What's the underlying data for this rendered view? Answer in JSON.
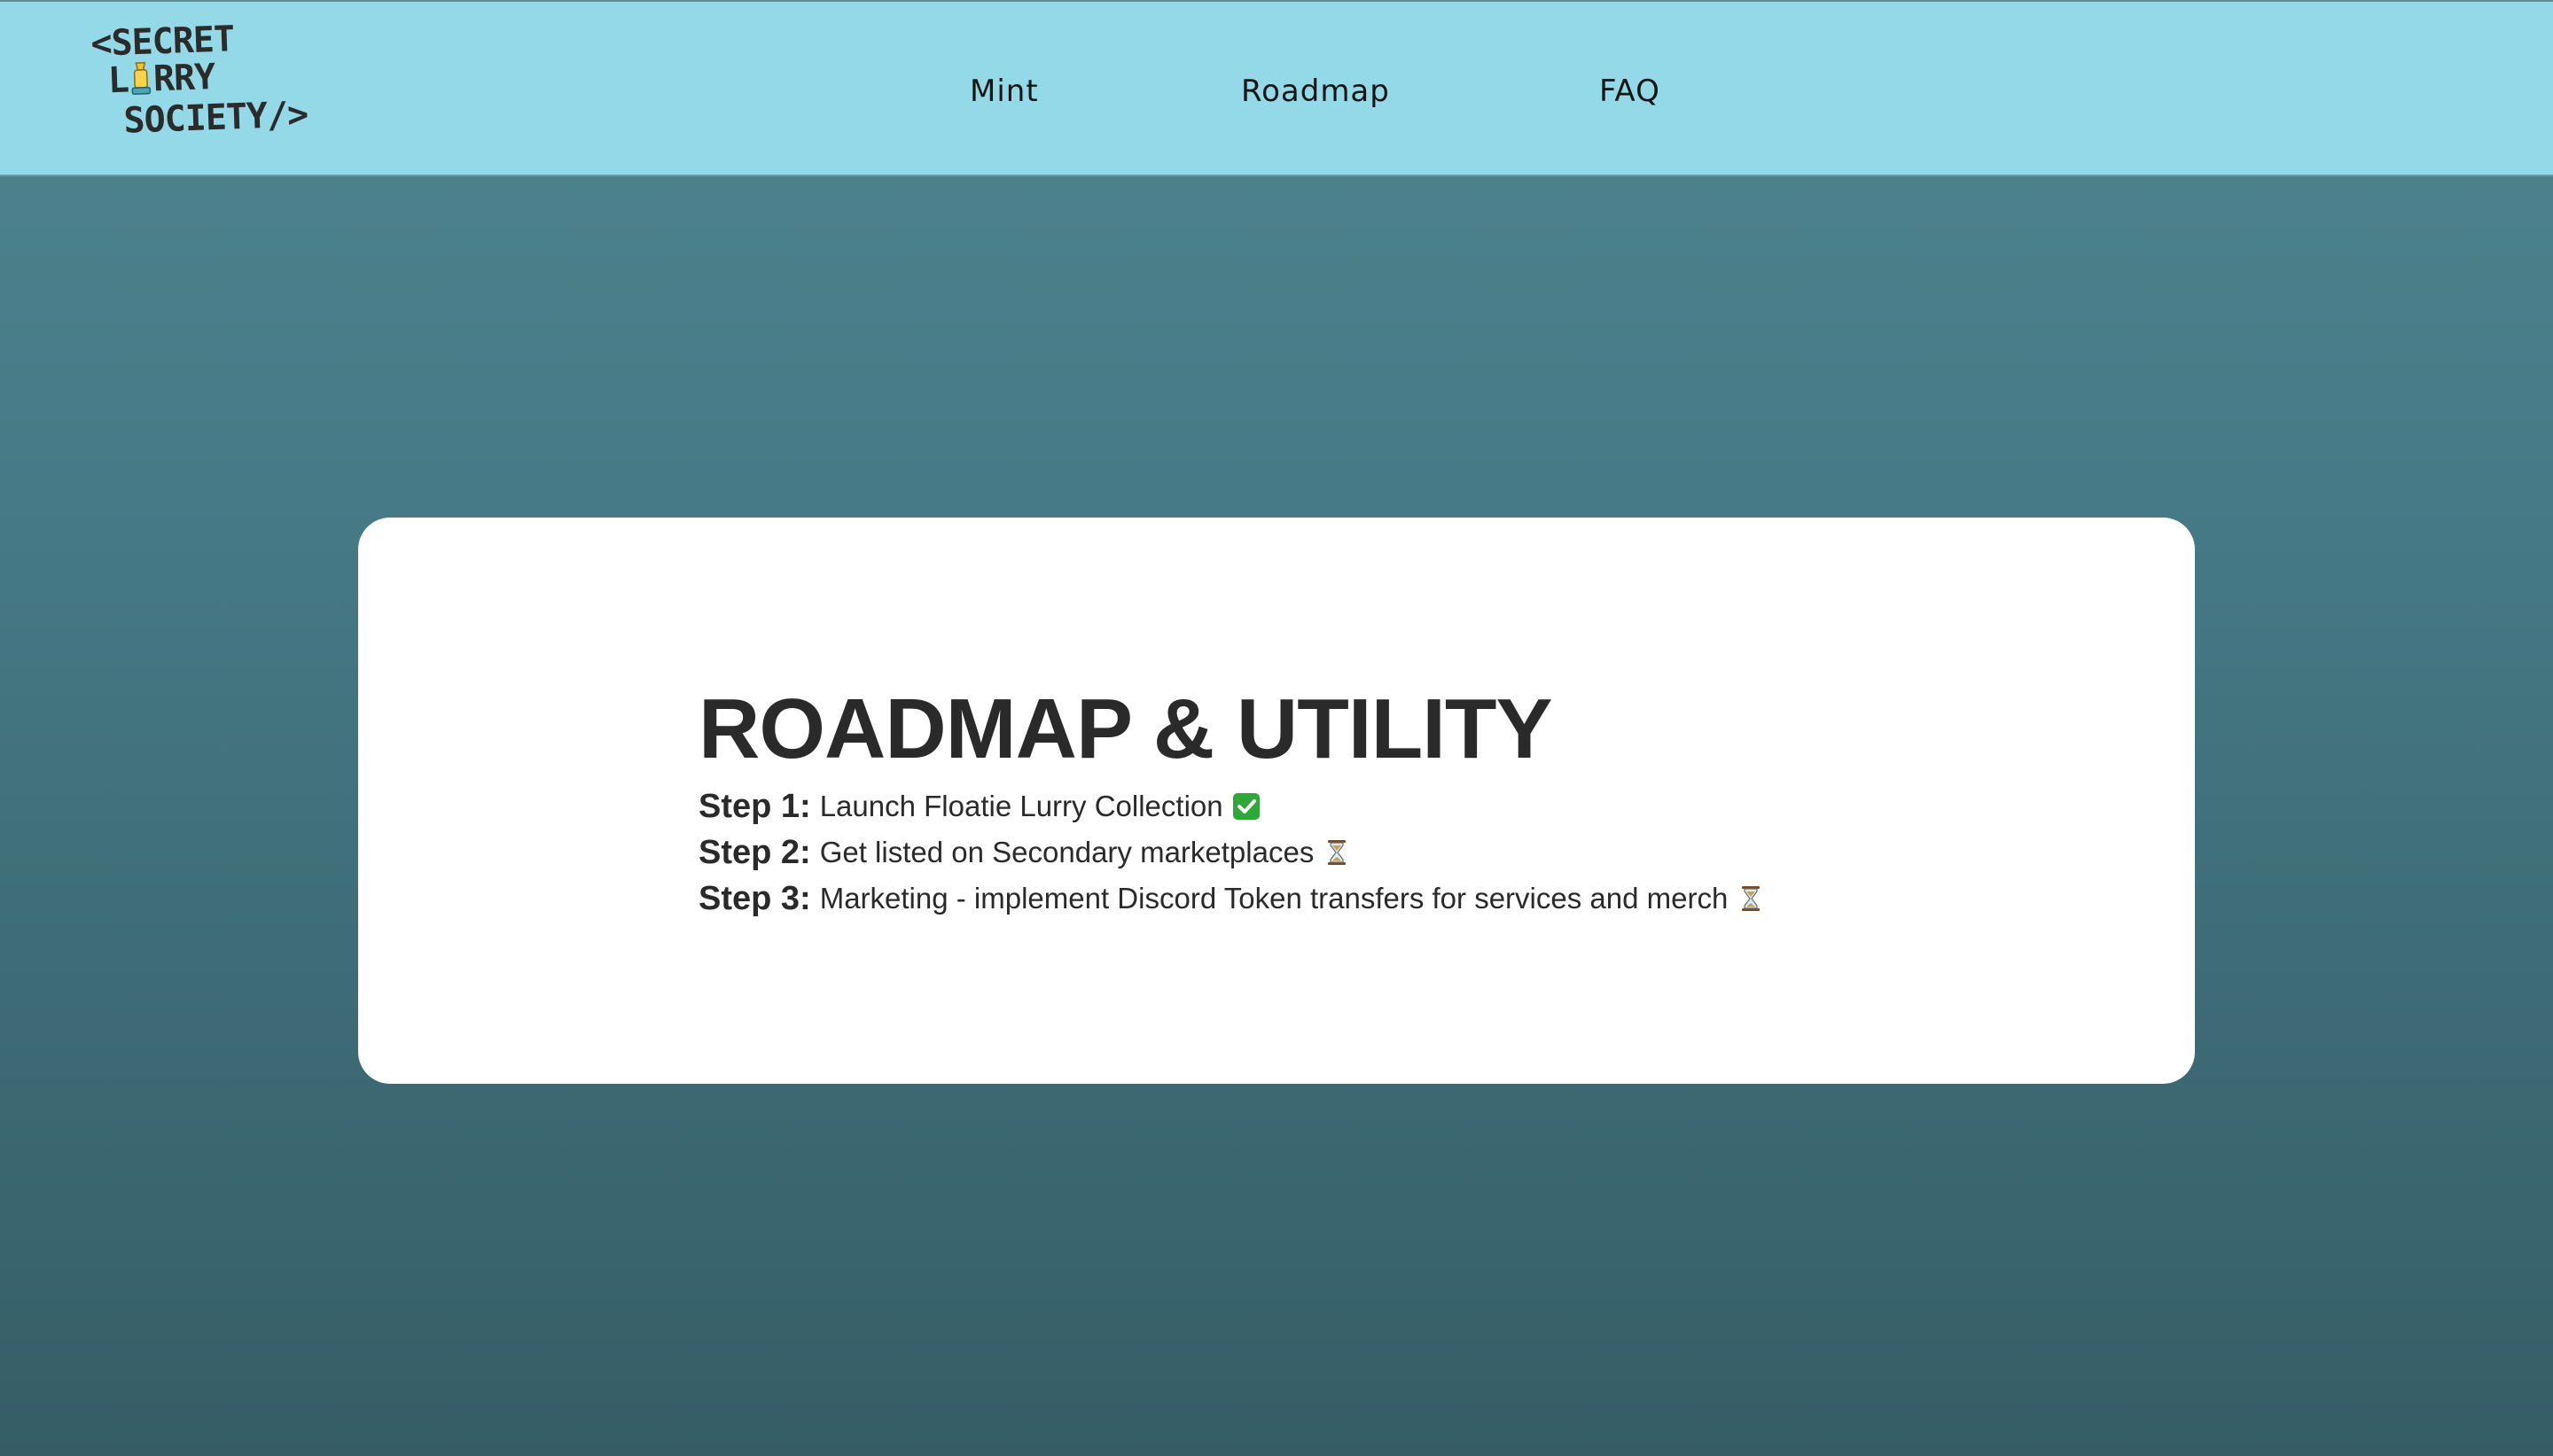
{
  "header": {
    "logo": {
      "line1": "<SECRET",
      "line2_prefix": "L",
      "line2_suffix": "RRY",
      "line3": "SOCIETY/>",
      "icon": "lamp-icon"
    },
    "nav": [
      {
        "label": "Mint"
      },
      {
        "label": "Roadmap"
      },
      {
        "label": "FAQ"
      }
    ]
  },
  "roadmap": {
    "title": "ROADMAP & UTILITY",
    "steps": [
      {
        "label": "Step 1:",
        "text": "Launch Floatie Lurry Collection",
        "status": "done",
        "icon": "check-icon"
      },
      {
        "label": "Step 2:",
        "text": "Get listed on Secondary marketplaces",
        "status": "pending",
        "icon": "hourglass-icon"
      },
      {
        "label": "Step 3:",
        "text": "Marketing - implement Discord Token transfers for services and merch",
        "status": "pending",
        "icon": "hourglass-icon"
      }
    ]
  },
  "colors": {
    "navbar_bg": "#93d9e7",
    "page_bg_top": "#4f8590",
    "page_bg_bottom": "#365d66",
    "card_bg": "#ffffff",
    "text": "#2a2a2a",
    "check_green": "#2fa83a"
  }
}
